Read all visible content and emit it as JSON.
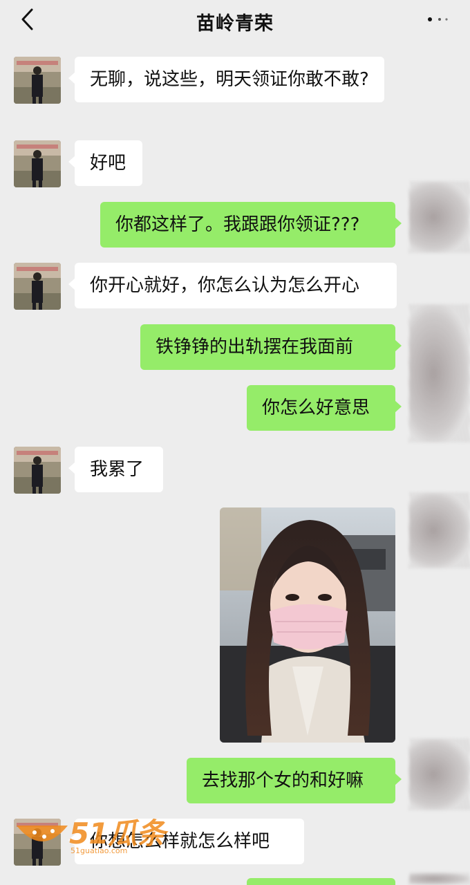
{
  "header": {
    "title": "苗岭青荣",
    "back_icon": "chevron-left-icon",
    "more_icon": "more-dots-icon"
  },
  "messages": [
    {
      "side": "left",
      "text": "无聊，说这些，明天领证你敢不敢?"
    },
    {
      "side": "left",
      "text": "好吧"
    },
    {
      "side": "right",
      "text": "你都这样了。我跟跟你领证???"
    },
    {
      "side": "left",
      "text": "你开心就好，你怎么认为怎么开心"
    },
    {
      "side": "right",
      "text": "铁铮铮的出轨摆在我面前"
    },
    {
      "side": "right",
      "text": "你怎么好意思"
    },
    {
      "side": "left",
      "text": "我累了"
    },
    {
      "side": "right",
      "type": "image"
    },
    {
      "side": "right",
      "text": "去找那个女的和好嘛"
    },
    {
      "side": "left",
      "text": "你想怎么样就怎么样吧"
    }
  ],
  "watermark": {
    "text": "51瓜条",
    "sub": "51guatiao.com"
  },
  "colors": {
    "background": "#ededed",
    "bubble_left": "#ffffff",
    "bubble_right": "#95ec69",
    "watermark": "#f08a1c"
  }
}
